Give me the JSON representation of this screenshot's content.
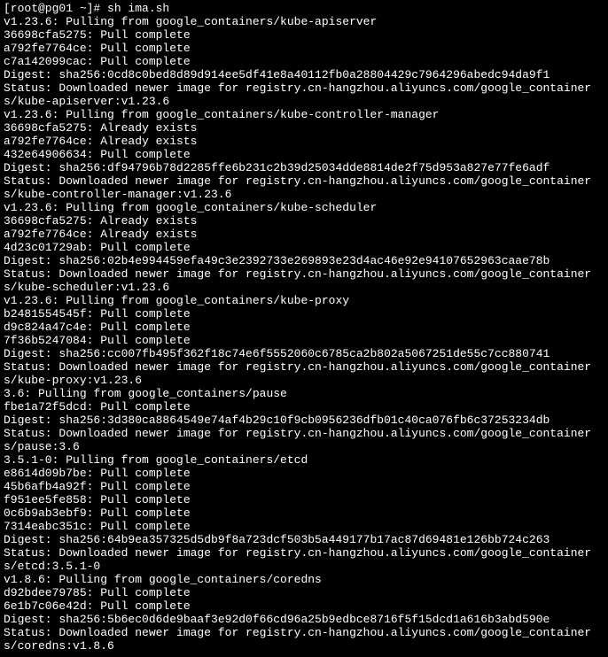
{
  "terminal": {
    "lines": [
      "[root@pg01 ~]# sh ima.sh",
      "v1.23.6: Pulling from google_containers/kube-apiserver",
      "36698cfa5275: Pull complete",
      "a792fe7764ce: Pull complete",
      "c7a142099cac: Pull complete",
      "Digest: sha256:0cd8c0bed8d89d914ee5df41e8a40112fb0a28804429c7964296abedc94da9f1",
      "Status: Downloaded newer image for registry.cn-hangzhou.aliyuncs.com/google_containers/kube-apiserver:v1.23.6",
      "v1.23.6: Pulling from google_containers/kube-controller-manager",
      "36698cfa5275: Already exists",
      "a792fe7764ce: Already exists",
      "432e64906634: Pull complete",
      "Digest: sha256:df94796b78d2285ffe6b231c2b39d25034dde8814de2f75d953a827e77fe6adf",
      "Status: Downloaded newer image for registry.cn-hangzhou.aliyuncs.com/google_containers/kube-controller-manager:v1.23.6",
      "v1.23.6: Pulling from google_containers/kube-scheduler",
      "36698cfa5275: Already exists",
      "a792fe7764ce: Already exists",
      "4d23c01729ab: Pull complete",
      "Digest: sha256:02b4e994459efa49c3e2392733e269893e23d4ac46e92e94107652963caae78b",
      "Status: Downloaded newer image for registry.cn-hangzhou.aliyuncs.com/google_containers/kube-scheduler:v1.23.6",
      "v1.23.6: Pulling from google_containers/kube-proxy",
      "b2481554545f: Pull complete",
      "d9c824a47c4e: Pull complete",
      "7f36b5247084: Pull complete",
      "Digest: sha256:cc007fb495f362f18c74e6f5552060c6785ca2b802a5067251de55c7cc880741",
      "Status: Downloaded newer image for registry.cn-hangzhou.aliyuncs.com/google_containers/kube-proxy:v1.23.6",
      "3.6: Pulling from google_containers/pause",
      "fbe1a72f5dcd: Pull complete",
      "Digest: sha256:3d380ca8864549e74af4b29c10f9cb0956236dfb01c40ca076fb6c37253234db",
      "Status: Downloaded newer image for registry.cn-hangzhou.aliyuncs.com/google_containers/pause:3.6",
      "3.5.1-0: Pulling from google_containers/etcd",
      "e8614d09b7be: Pull complete",
      "45b6afb4a92f: Pull complete",
      "f951ee5fe858: Pull complete",
      "0c6b9ab3ebf9: Pull complete",
      "7314eabc351c: Pull complete",
      "Digest: sha256:64b9ea357325d5db9f8a723dcf503b5a449177b17ac87d69481e126bb724c263",
      "Status: Downloaded newer image for registry.cn-hangzhou.aliyuncs.com/google_containers/etcd:3.5.1-0",
      "v1.8.6: Pulling from google_containers/coredns",
      "d92bdee79785: Pull complete",
      "6e1b7c06e42d: Pull complete",
      "Digest: sha256:5b6ec0d6de9baaf3e92d0f66cd96a25b9edbce8716f5f15dcd1a616b3abd590e",
      "Status: Downloaded newer image for registry.cn-hangzhou.aliyuncs.com/google_containers/coredns:v1.8.6"
    ]
  }
}
